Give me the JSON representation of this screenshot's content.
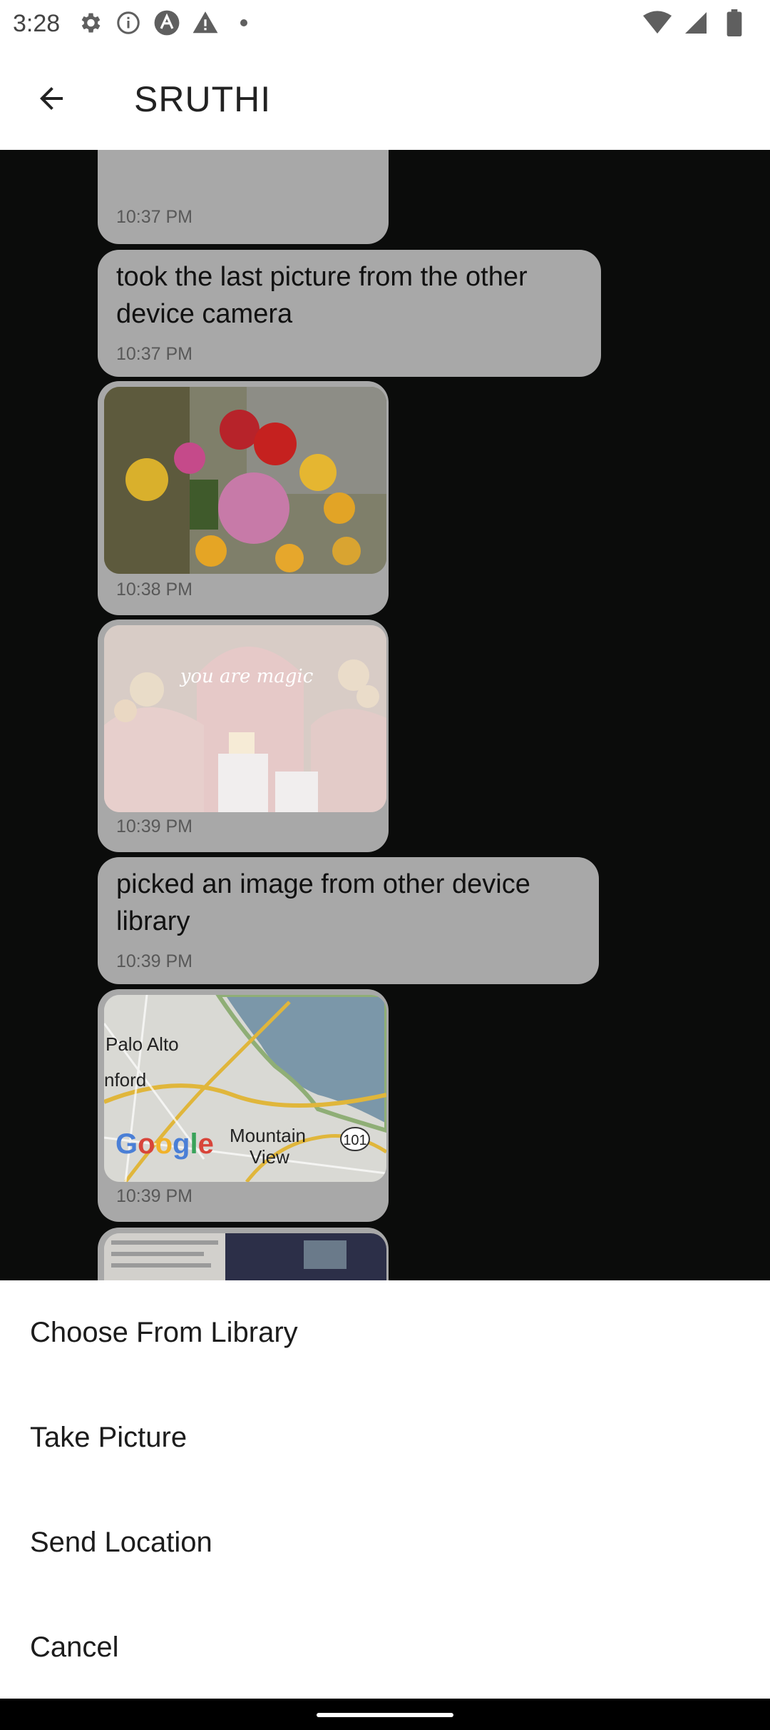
{
  "status_bar": {
    "time": "3:28",
    "icons_left": [
      "settings-icon",
      "info-icon",
      "a-icon",
      "warning-icon",
      "dot-icon"
    ],
    "icons_right": [
      "wifi-icon",
      "signal-icon",
      "battery-icon"
    ]
  },
  "app_bar": {
    "title": "SRUTHI",
    "back_icon": "arrow-back-icon"
  },
  "messages": [
    {
      "type": "text",
      "text": "",
      "time": "10:37 PM"
    },
    {
      "type": "text",
      "text": "took the last picture from the other device camera",
      "time": "10:37 PM"
    },
    {
      "type": "image",
      "subject": "flowers",
      "time": "10:38 PM"
    },
    {
      "type": "image",
      "subject": "party decor",
      "photo_text": "you are magic",
      "time": "10:39 PM"
    },
    {
      "type": "text",
      "text": "picked an image from other device library",
      "time": "10:39 PM"
    },
    {
      "type": "image",
      "subject": "map",
      "map_labels": [
        "Palo Alto",
        "nford",
        "Mountain View",
        "101",
        "Google"
      ],
      "time": "10:39 PM"
    },
    {
      "type": "image",
      "subject": "screenshot",
      "time": ""
    }
  ],
  "sheet": {
    "items": [
      "Choose From Library",
      "Take Picture",
      "Send Location",
      "Cancel"
    ]
  },
  "colors": {
    "overlay_bg": "#0b0c0b",
    "bubble_bg": "#a8a8a8",
    "sheet_bg": "#ffffff"
  }
}
